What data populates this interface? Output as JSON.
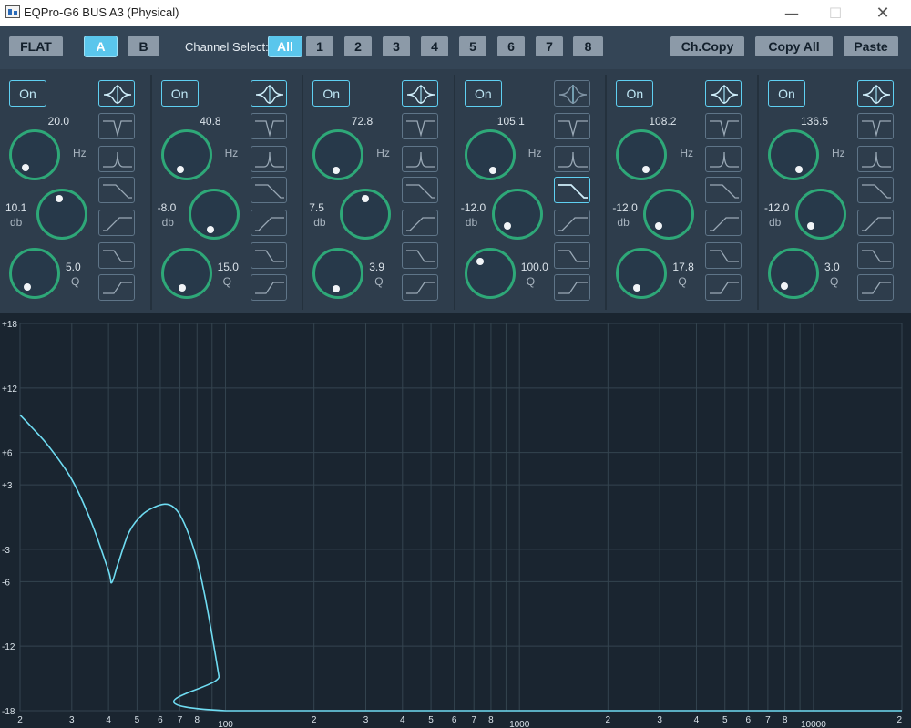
{
  "window": {
    "title": "EQPro-G6 BUS A3 (Physical)"
  },
  "toolbar": {
    "flat": "FLAT",
    "a": "A",
    "b": "B",
    "channel_select_label": "Channel Select:",
    "channels": [
      "All",
      "1",
      "2",
      "3",
      "4",
      "5",
      "6",
      "7",
      "8"
    ],
    "selected_channel": "All",
    "ch_copy": "Ch.Copy",
    "copy_all": "Copy All",
    "paste": "Paste"
  },
  "colors": {
    "accent": "#5ac6ec",
    "knob_ring": "#2ea878",
    "curve": "#6fdcf2",
    "bg": "#1a2530"
  },
  "bands": [
    {
      "on": "On",
      "freq": "20.0",
      "gain": "10.1",
      "q": "5.0",
      "freq_unit": "Hz",
      "gain_unit": "db",
      "q_unit": "Q",
      "freq_angle": 235,
      "gain_angle": 100,
      "q_angle": 240,
      "active_type": "peak"
    },
    {
      "on": "On",
      "freq": "40.8",
      "gain": "-8.0",
      "q": "15.0",
      "freq_unit": "Hz",
      "gain_unit": "db",
      "q_unit": "Q",
      "freq_angle": 248,
      "gain_angle": 258,
      "q_angle": 255,
      "active_type": "peak"
    },
    {
      "on": "On",
      "freq": "72.8",
      "gain": "7.5",
      "q": "3.9",
      "freq_unit": "Hz",
      "gain_unit": "db",
      "q_unit": "Q",
      "freq_angle": 262,
      "gain_angle": 92,
      "q_angle": 262,
      "active_type": "peak"
    },
    {
      "on": "On",
      "freq": "105.1",
      "gain": "-12.0",
      "q": "100.0",
      "freq_unit": "Hz",
      "gain_unit": "db",
      "q_unit": "Q",
      "freq_angle": 282,
      "gain_angle": 230,
      "q_angle": 128,
      "active_type": "highcut"
    },
    {
      "on": "On",
      "freq": "108.2",
      "gain": "-12.0",
      "q": "17.8",
      "freq_unit": "Hz",
      "gain_unit": "db",
      "q_unit": "Q",
      "freq_angle": 284,
      "gain_angle": 230,
      "q_angle": 252,
      "active_type": "peak"
    },
    {
      "on": "On",
      "freq": "136.5",
      "gain": "-12.0",
      "q": "3.0",
      "freq_unit": "Hz",
      "gain_unit": "db",
      "q_unit": "Q",
      "freq_angle": 292,
      "gain_angle": 230,
      "q_angle": 233,
      "active_type": "peak"
    }
  ],
  "filter_types": [
    "peak",
    "notch",
    "bandpass",
    "highcut",
    "lowcut",
    "highshelf",
    "lowshelf"
  ],
  "graph": {
    "y_ticks": [
      "+18",
      "+12",
      "+6",
      "+3",
      "-3",
      "-6",
      "-12",
      "-18"
    ],
    "y_values": [
      18,
      12,
      6,
      3,
      -3,
      -6,
      -12,
      -18
    ],
    "x_labels": [
      {
        "f": 20,
        "t": "2"
      },
      {
        "f": 30,
        "t": "3"
      },
      {
        "f": 40,
        "t": "4"
      },
      {
        "f": 50,
        "t": "5"
      },
      {
        "f": 60,
        "t": "6"
      },
      {
        "f": 70,
        "t": "7"
      },
      {
        "f": 80,
        "t": "8"
      },
      {
        "f": 100,
        "t": "100"
      },
      {
        "f": 200,
        "t": "2"
      },
      {
        "f": 300,
        "t": "3"
      },
      {
        "f": 400,
        "t": "4"
      },
      {
        "f": 500,
        "t": "5"
      },
      {
        "f": 600,
        "t": "6"
      },
      {
        "f": 700,
        "t": "7"
      },
      {
        "f": 800,
        "t": "8"
      },
      {
        "f": 1000,
        "t": "1000"
      },
      {
        "f": 2000,
        "t": "2"
      },
      {
        "f": 3000,
        "t": "3"
      },
      {
        "f": 4000,
        "t": "4"
      },
      {
        "f": 5000,
        "t": "5"
      },
      {
        "f": 6000,
        "t": "6"
      },
      {
        "f": 7000,
        "t": "7"
      },
      {
        "f": 8000,
        "t": "8"
      },
      {
        "f": 10000,
        "t": "10000"
      },
      {
        "f": 20000,
        "t": "2"
      }
    ],
    "grid_freqs": [
      20,
      30,
      40,
      50,
      60,
      70,
      80,
      90,
      100,
      200,
      300,
      400,
      500,
      600,
      700,
      800,
      900,
      1000,
      2000,
      3000,
      4000,
      5000,
      6000,
      7000,
      8000,
      9000,
      10000,
      20000
    ],
    "xlim": [
      20,
      20000
    ],
    "ylim": [
      -18,
      18
    ],
    "curve": [
      [
        20,
        9.5
      ],
      [
        22,
        8.3
      ],
      [
        25,
        6.6
      ],
      [
        30,
        3.5
      ],
      [
        35,
        -0.5
      ],
      [
        40,
        -5.0
      ],
      [
        41,
        -6.1
      ],
      [
        43,
        -4.4
      ],
      [
        47,
        -1.4
      ],
      [
        52,
        0.2
      ],
      [
        57,
        0.9
      ],
      [
        62,
        1.2
      ],
      [
        66,
        1.0
      ],
      [
        70,
        0.2
      ],
      [
        75,
        -1.6
      ],
      [
        80,
        -4.0
      ],
      [
        85,
        -7.3
      ],
      [
        90,
        -11.0
      ],
      [
        95,
        -14.8
      ],
      [
        100,
        -18
      ],
      [
        20000,
        -18
      ]
    ]
  }
}
